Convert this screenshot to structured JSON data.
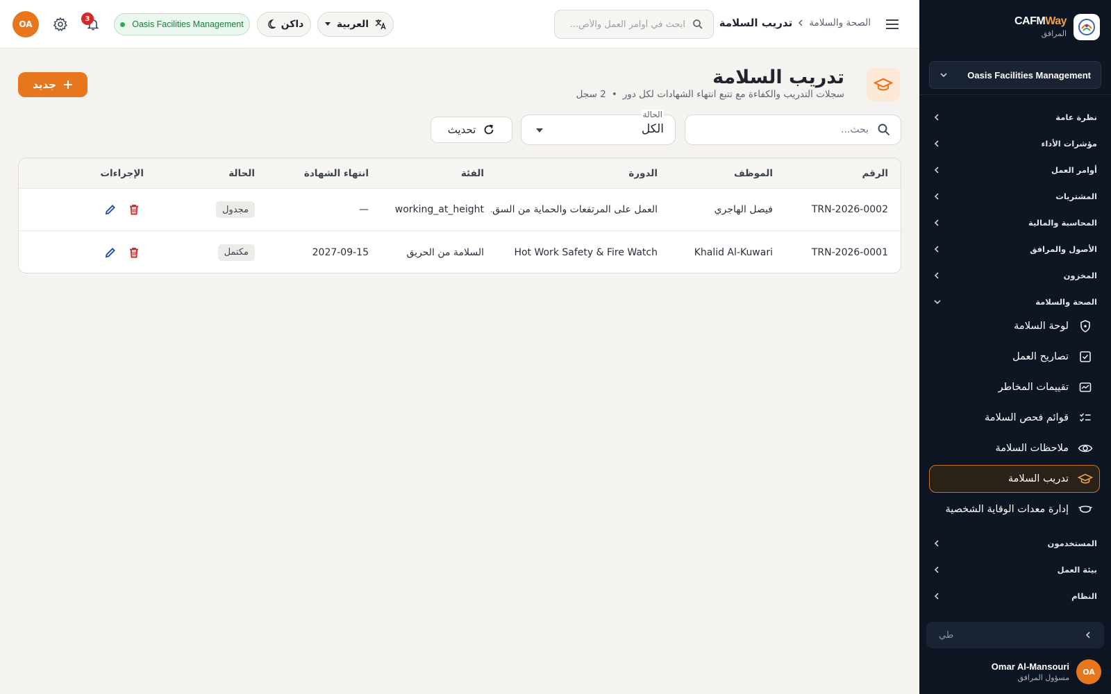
{
  "sidebar": {
    "brand": {
      "name_a": "CAFM",
      "name_b": "Way",
      "sub": "المرافق"
    },
    "org_selector": "Oasis Facilities Management",
    "sections": [
      {
        "label": "نظرة عامة"
      },
      {
        "label": "مؤشرات الأداء"
      },
      {
        "label": "أوامر العمل"
      },
      {
        "label": "المشتريات"
      },
      {
        "label": "المحاسبة والمالية"
      },
      {
        "label": "الأصول والمرافق"
      },
      {
        "label": "المخزون"
      },
      {
        "label": "الصحة والسلامة"
      },
      {
        "label": "المستخدمون"
      },
      {
        "label": "بيئة العمل"
      },
      {
        "label": "النظام"
      }
    ],
    "submenu": [
      {
        "label": "لوحة السلامة",
        "icon": "shield-icon"
      },
      {
        "label": "تصاريح العمل",
        "icon": "checkbox-icon"
      },
      {
        "label": "تقييمات المخاطر",
        "icon": "risk-icon"
      },
      {
        "label": "قوائم فحص السلامة",
        "icon": "checklist-icon"
      },
      {
        "label": "ملاحظات السلامة",
        "icon": "eye-icon"
      },
      {
        "label": "تدريب السلامة",
        "icon": "graduation-cap-icon",
        "active": true
      },
      {
        "label": "إدارة معدات الوقاية الشخصية",
        "icon": "mask-icon"
      }
    ],
    "search_text": "طي",
    "user": {
      "initials": "OA",
      "name": "Omar Al-Mansouri",
      "role": "مسؤول المرافق"
    }
  },
  "header": {
    "breadcrumb": {
      "parent": "الصحة والسلامة",
      "current": "تدريب السلامة"
    },
    "search_placeholder": "ابحث في أوامر العمل والأص...",
    "language": "العربية",
    "theme": "داكن",
    "org_badge": "Oasis Facilities Management",
    "notifications_count": "3",
    "avatar_initials": "OA"
  },
  "page": {
    "title": "تدريب السلامة",
    "subtitle": "سجلات التدريب والكفاءة مع تتبع انتهاء الشهادات لكل دور",
    "record_count": "2 سجل",
    "new_button": "جديد",
    "search_placeholder": "بحث...",
    "status_filter": {
      "label": "الحالة",
      "value": "الكل"
    },
    "refresh_button": "تحديث"
  },
  "table": {
    "columns": [
      "الرقم",
      "الموظف",
      "الدورة",
      "الفئة",
      "انتهاء الشهادة",
      "الحالة",
      "الإجراءات"
    ],
    "rows": [
      {
        "number": "TRN-2026-0002",
        "employee": "فيصل الهاجري",
        "course": "العمل على المرتفعات والحماية من السق...",
        "category": "working_at_height",
        "expiry": "—",
        "status": "مجدول"
      },
      {
        "number": "TRN-2026-0001",
        "employee": "Khalid Al-Kuwari",
        "course": "Hot Work Safety & Fire Watch",
        "category": "السلامة من الحريق",
        "expiry": "2027-09-15",
        "status": "مكتمل"
      }
    ]
  },
  "colors": {
    "accent": "#e8761c",
    "sidebar_bg": "#0f1623",
    "danger": "#d62828",
    "edit": "#1f4fa0",
    "success": "#2bab5c"
  }
}
